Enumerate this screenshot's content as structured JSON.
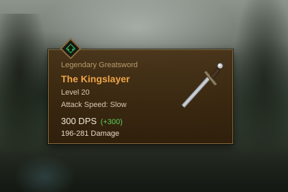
{
  "item": {
    "rarity_type": "Legendary Greatsword",
    "name": "The Kingslayer",
    "level": "Level 20",
    "attack_speed": "Attack Speed: Slow",
    "dps": "300 DPS",
    "dps_bonus": "(+300)",
    "damage": "196-281 Damage",
    "icon": "greatsword-icon",
    "upgrade_icon": "upgrade-arrow-icon"
  },
  "colors": {
    "title": "#f0a548",
    "bonus": "#5bd35b",
    "border": "#8a6d3e",
    "upgrade": "#3fd06a"
  }
}
